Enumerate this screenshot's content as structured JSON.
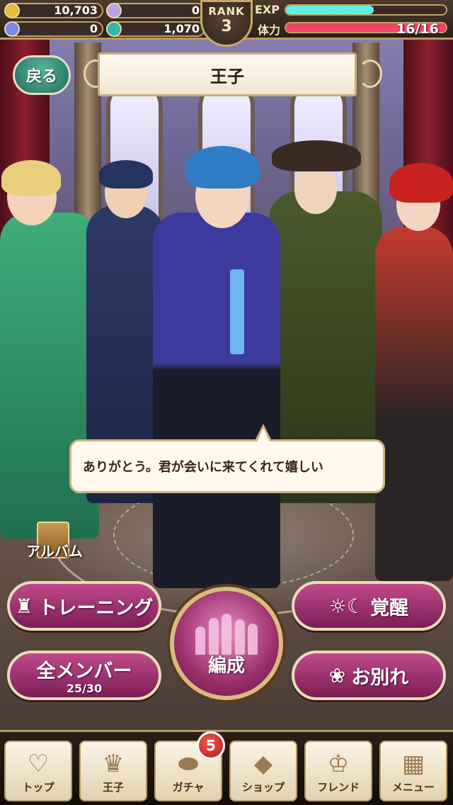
{
  "status": {
    "gold": "10,703",
    "feather": "0",
    "crystal": "0",
    "coin": "1,070",
    "rank_label": "RANK",
    "rank_value": "3",
    "exp_label": "EXP",
    "exp_fraction": 0.55,
    "stamina_label": "体力",
    "stamina_text": "16/16",
    "stamina_fraction": 1.0
  },
  "header": {
    "back_label": "戻る",
    "title": "王子"
  },
  "dialogue": {
    "text": "ありがとう。君が会いに来てくれて嬉しい"
  },
  "album": {
    "label": "アルバム"
  },
  "actions": {
    "training_label": "トレーニング",
    "awaken_label": "覚醒",
    "members_label": "全メンバー",
    "members_count": "25/30",
    "farewell_label": "お別れ",
    "formation_label": "編成"
  },
  "nav": {
    "items": [
      {
        "label": "トップ",
        "icon": "heart-icon"
      },
      {
        "label": "王子",
        "icon": "crown-icon"
      },
      {
        "label": "ガチャ",
        "icon": "egg-icon"
      },
      {
        "label": "ショップ",
        "icon": "gem-icon"
      },
      {
        "label": "フレンド",
        "icon": "tiara-icon"
      },
      {
        "label": "メニュー",
        "icon": "grid-icon"
      }
    ],
    "gacha_badge": "5"
  },
  "colors": {
    "accent_gold": "#c9a86a",
    "button_pink": "#c04a8c",
    "exp_bar": "#5ff0e6",
    "stamina_bar": "#f0446a"
  }
}
